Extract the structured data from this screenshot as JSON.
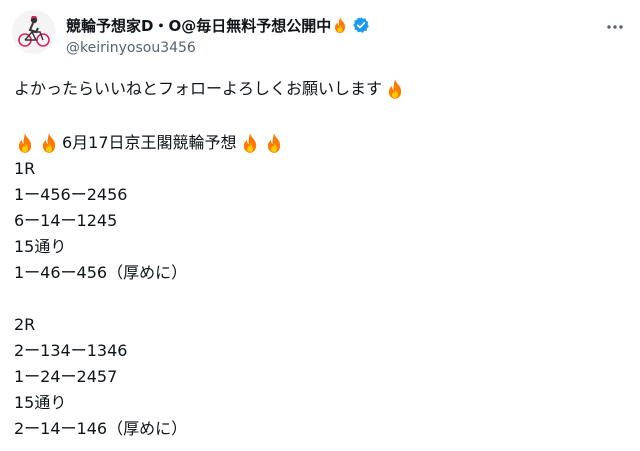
{
  "author": {
    "display_name": "競輪予想家D・O@毎日無料予想公開中",
    "handle": "@keirinyosou3456",
    "verified": true,
    "avatar_icon": "cyclist-icon"
  },
  "more_button_icon": "more-horizontal-icon",
  "tweet": {
    "intro": "よかったらいいねとフォローよろしくお願いします",
    "heading": "6月17日京王閣競輪予想",
    "races": [
      {
        "label": "1R",
        "lines": [
          "1ー456ー2456",
          "6ー14ー1245",
          "15通り",
          "1ー46ー456（厚めに）"
        ]
      },
      {
        "label": "2R",
        "lines": [
          "2ー134ー1346",
          "1ー24ー2457",
          "15通り",
          "2ー14ー146（厚めに）"
        ]
      }
    ]
  },
  "colors": {
    "text": "#0f1419",
    "handle": "#536471",
    "verified": "#1d9bf0",
    "fire_outer": "#ff7a00",
    "fire_inner": "#ffcc00"
  }
}
